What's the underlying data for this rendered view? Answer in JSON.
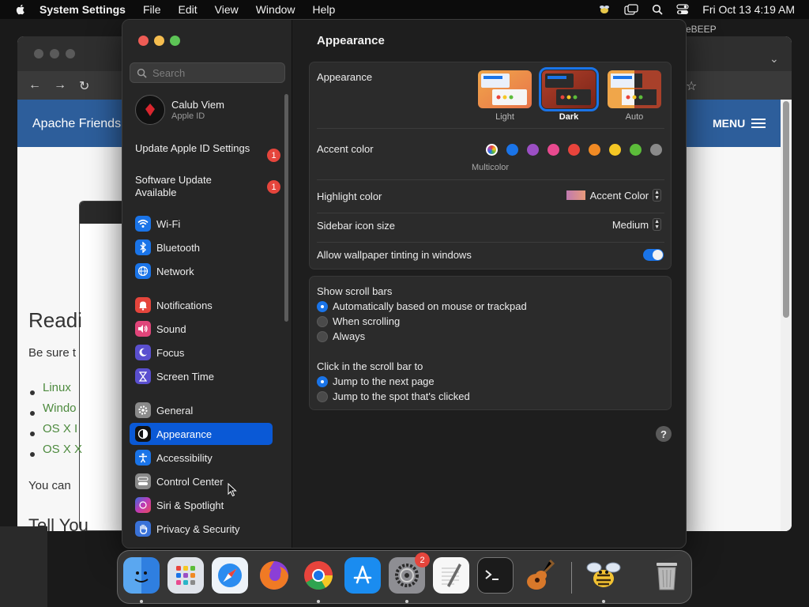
{
  "menubar": {
    "app_name": "System Settings",
    "items": [
      "File",
      "Edit",
      "View",
      "Window",
      "Help"
    ],
    "clock": "Fri Oct 13  4:19 AM"
  },
  "background_window": {
    "banner_title": "Apache Friends",
    "menu_label": "MENU",
    "heading": "Readi",
    "para": "Be sure t",
    "links": [
      "Linux",
      "Windo",
      "OS X I",
      "OS X X"
    ],
    "para2": "You can",
    "para3": "Tell You",
    "beep_text": "eBEEP"
  },
  "settings": {
    "search_placeholder": "Search",
    "account": {
      "name": "Calub Viem",
      "subtitle": "Apple ID"
    },
    "notices": [
      {
        "label": "Update Apple ID Settings",
        "badge": "1"
      },
      {
        "label": "Software Update Available",
        "badge": "1"
      }
    ],
    "sidebar_items": [
      {
        "label": "Wi-Fi",
        "icon": "wifi-icon",
        "color": "#1a74e8"
      },
      {
        "label": "Bluetooth",
        "icon": "bluetooth-icon",
        "color": "#1a74e8"
      },
      {
        "label": "Network",
        "icon": "globe-icon",
        "color": "#1a74e8"
      },
      {
        "label": "Notifications",
        "icon": "bell-icon",
        "color": "#e5453c"
      },
      {
        "label": "Sound",
        "icon": "speaker-icon",
        "color": "#e0457a"
      },
      {
        "label": "Focus",
        "icon": "moon-icon",
        "color": "#5a4fcf"
      },
      {
        "label": "Screen Time",
        "icon": "hourglass-icon",
        "color": "#5a4fcf"
      },
      {
        "label": "General",
        "icon": "gear-icon",
        "color": "#8a8a8a"
      },
      {
        "label": "Appearance",
        "icon": "appearance-icon",
        "color": "#111111"
      },
      {
        "label": "Accessibility",
        "icon": "accessibility-icon",
        "color": "#1a74e8"
      },
      {
        "label": "Control Center",
        "icon": "control-center-icon",
        "color": "#8a8a8a"
      },
      {
        "label": "Siri & Spotlight",
        "icon": "siri-icon",
        "color": "#c03bb5"
      },
      {
        "label": "Privacy & Security",
        "icon": "hand-icon",
        "color": "#3a72d8"
      }
    ],
    "main": {
      "title": "Appearance",
      "appearance_label": "Appearance",
      "appearance_options": [
        "Light",
        "Dark",
        "Auto"
      ],
      "appearance_selected": "Dark",
      "accent_label": "Accent color",
      "accent_colors": [
        "#b05cd8",
        "#1a74e8",
        "#9b4fc4",
        "#e84a8f",
        "#e8443c",
        "#f08a24",
        "#f5c724",
        "#5cbc3a",
        "#8a8a8a"
      ],
      "accent_multicolor_label": "Multicolor",
      "highlight_label": "Highlight color",
      "highlight_value": "Accent Color",
      "sidebar_icon_label": "Sidebar icon size",
      "sidebar_icon_value": "Medium",
      "wallpaper_label": "Allow wallpaper tinting in windows",
      "wallpaper_on": true,
      "scroll_bars_label": "Show scroll bars",
      "scroll_bar_options": [
        "Automatically based on mouse or trackpad",
        "When scrolling",
        "Always"
      ],
      "click_label": "Click in the scroll bar to",
      "click_options": [
        "Jump to the next page",
        "Jump to the spot that's clicked"
      ],
      "help_label": "?"
    }
  },
  "dock": {
    "items": [
      "finder-icon",
      "launchpad-icon",
      "safari-icon",
      "firefox-icon",
      "chrome-icon",
      "app-store-icon",
      "system-settings-icon",
      "textedit-icon",
      "terminal-icon",
      "garageband-icon",
      "cyberduck-icon",
      "trash-icon"
    ],
    "settings_badge": "2"
  }
}
